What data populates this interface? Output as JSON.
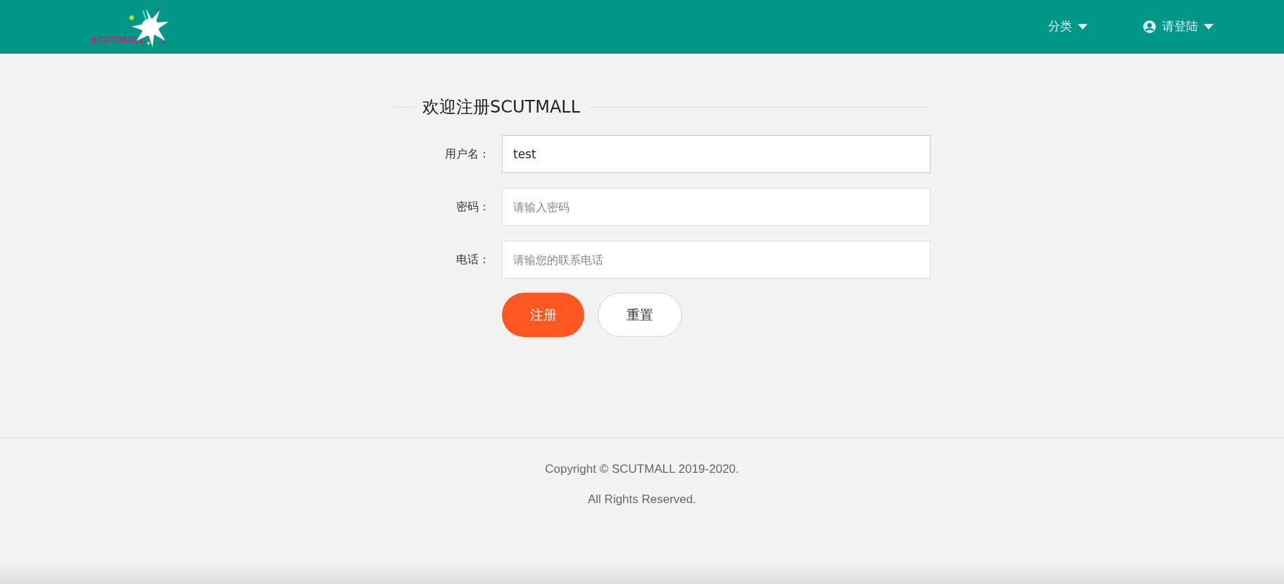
{
  "header": {
    "logo": "SCUTMALL",
    "nav": [
      {
        "label": "分类",
        "kind": "menu"
      },
      {
        "label": "请登陆",
        "kind": "user"
      }
    ]
  },
  "form": {
    "title": "欢迎注册SCUTMALL",
    "fields": [
      {
        "label": "用户名：",
        "value": "test"
      },
      {
        "label": "密码：",
        "placeholder": "请输入密码"
      },
      {
        "label": "电话：",
        "placeholder": "请输您的联系电话"
      }
    ],
    "buttons": [
      {
        "label": "注册",
        "kind": "primary"
      },
      {
        "label": "重置",
        "kind": "secondary"
      }
    ]
  },
  "footer": {
    "lines": [
      "Copyright © SCUTMALL 2019-2020.",
      "All Rights Reserved."
    ]
  }
}
